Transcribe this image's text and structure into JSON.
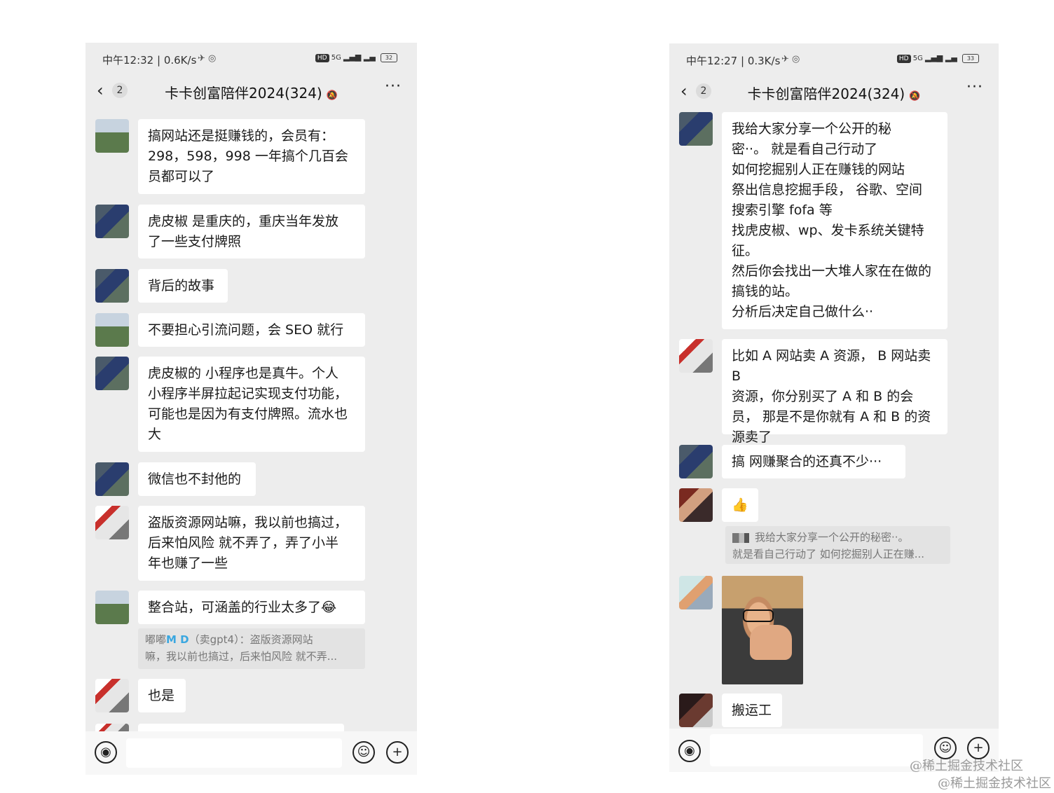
{
  "left": {
    "status": {
      "time": "中午12:32 | 0.6K/s",
      "icons": "✈ ◎",
      "network": "5G",
      "battery": "32"
    },
    "header": {
      "back_icon": "‹",
      "unread": "2",
      "title": "卡卡创富陪伴2024(324)",
      "more": "···"
    },
    "messages": [
      {
        "text": "搞网站还是挺赚钱的，会员有：\n298，598，998 一年搞个几百会\n员都可以了"
      },
      {
        "text": "虎皮椒 是重庆的，重庆当年发放\n了一些支付牌照"
      },
      {
        "text": "背后的故事"
      },
      {
        "text": "不要担心引流问题，会 SEO 就行"
      },
      {
        "text": "虎皮椒的 小程序也是真牛。个人\n小程序半屏拉起记实现支付功能，\n可能也是因为有支付牌照。流水也\n大"
      },
      {
        "text": "微信也不封他的"
      },
      {
        "text": "盗版资源网站嘛，我以前也搞过，\n后来怕风险 就不弄了，弄了小半\n年也赚了一些"
      },
      {
        "text": "整合站，可涵盖的行业太多了😂"
      },
      {
        "text": "也是"
      }
    ],
    "quote": {
      "name": "嘟嘟",
      "md": "M D",
      "tag": "（卖gpt4）：盗版资源网站",
      "line2": "嘛，我以前也搞过，后来怕风险 就不弄..."
    }
  },
  "right": {
    "status": {
      "time": "中午12:27 | 0.3K/s",
      "icons": "✈ ◎",
      "network": "5G",
      "battery": "33"
    },
    "header": {
      "back_icon": "‹",
      "unread": "2",
      "title": "卡卡创富陪伴2024(324)",
      "more": "···"
    },
    "messages": [
      {
        "text": "我给大家分享一个公开的秘\n密··。 就是看自己行动了\n如何挖掘别人正在赚钱的网站\n祭出信息挖掘手段，  谷歌、空间\n搜索引擎 fofa 等\n找虎皮椒、wp、发卡系统关键特\n征。\n然后你会找出一大堆人家在在做的\n搞钱的站。\n分析后决定自己做什么··"
      },
      {
        "text": "比如 A 网站卖 A 资源， B 网站卖 B\n资源，你分别买了 A 和 B 的会\n员， 那是不是你就有 A 和 B 的资\n源卖了"
      },
      {
        "text": "搞 网赚聚合的还真不少···"
      },
      {
        "text": "👍"
      },
      {
        "text": "搬运工"
      }
    ],
    "quote": {
      "line1": "我给大家分享一个公开的秘密··。",
      "line2": "就是看自己行动了 如何挖掘别人正在赚..."
    }
  },
  "icons": {
    "voice": "voice-icon",
    "emoji": "emoji-icon",
    "plus": "plus-icon"
  },
  "watermarks": {
    "w1": "@稀土掘金技术社区",
    "w2": "@稀土掘金技术社区"
  }
}
